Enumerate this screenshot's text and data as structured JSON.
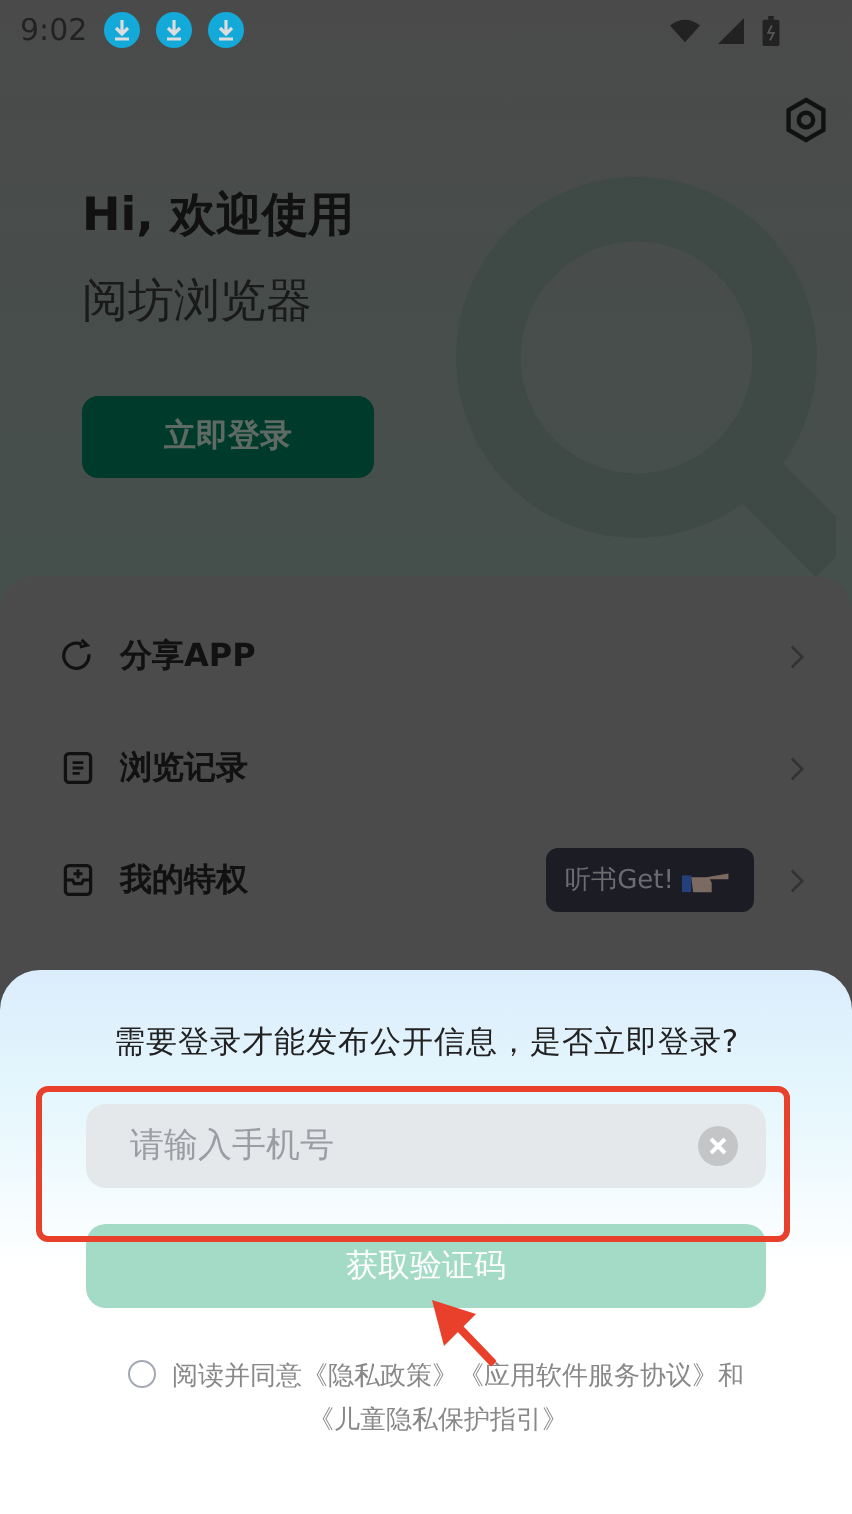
{
  "status_bar": {
    "time": "9:02"
  },
  "header": {
    "greeting": "Hi, 欢迎使用",
    "app_name": "阅坊浏览器",
    "login_button": "立即登录"
  },
  "menu": [
    {
      "kind": "share",
      "label": "分享APP"
    },
    {
      "kind": "history",
      "label": "浏览记录"
    },
    {
      "kind": "privilege",
      "label": "我的特权",
      "badge": "听书Get!"
    }
  ],
  "login_sheet": {
    "question": "需要登录才能发布公开信息，是否立即登录?",
    "phone_field": {
      "placeholder": "请输入手机号"
    },
    "code_button": "获取验证码",
    "agreement": {
      "checked": false,
      "lines": [
        "阅读并同意《隐私政策》《应用软件服务协议》和",
        "《儿童隐私保护指引》"
      ]
    }
  }
}
